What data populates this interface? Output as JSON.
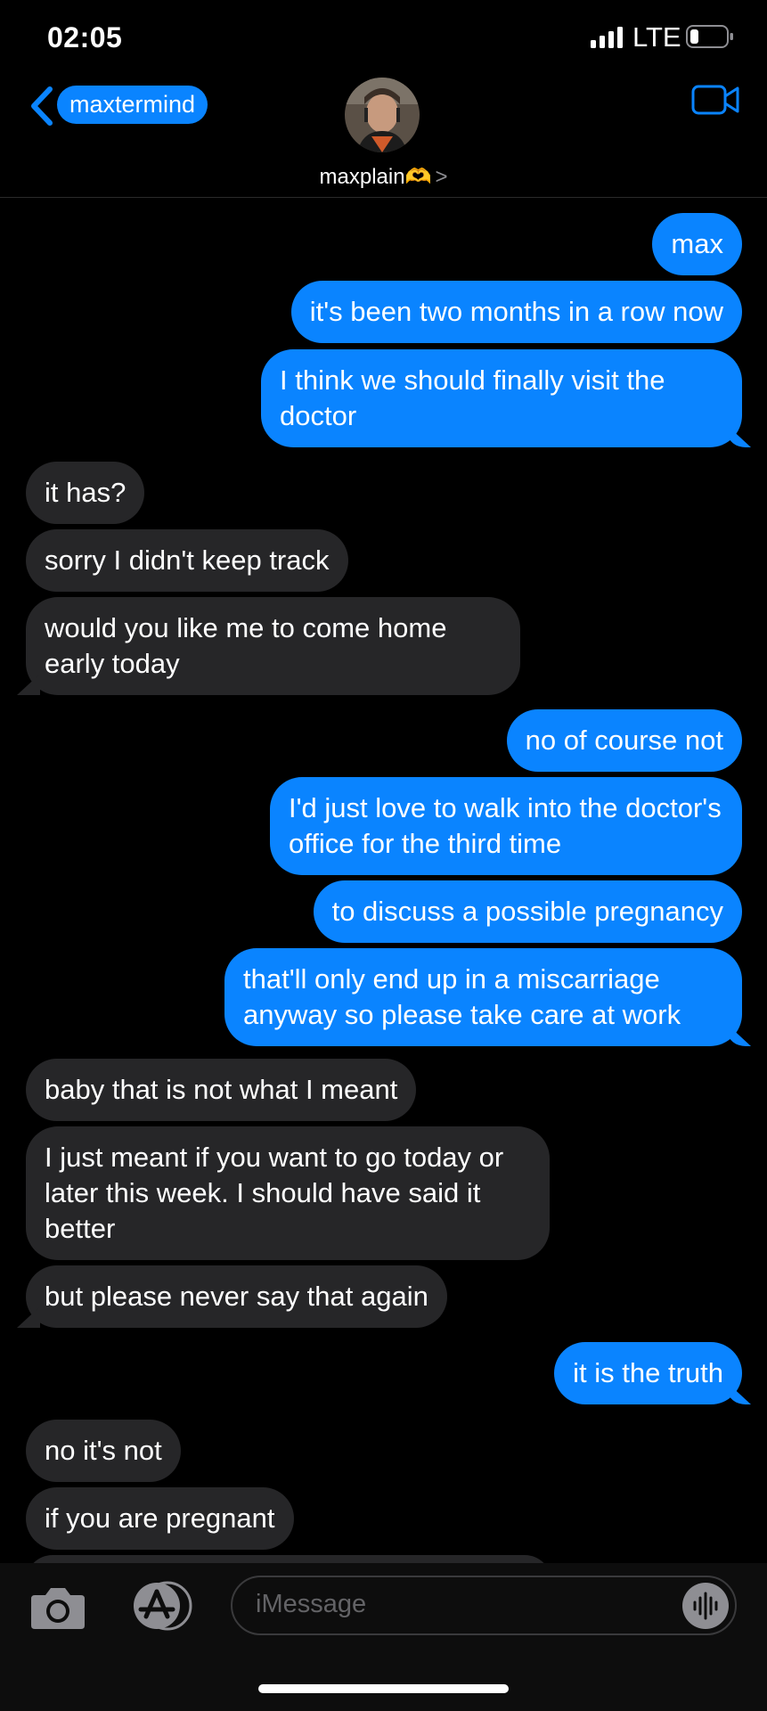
{
  "status": {
    "time": "02:05",
    "network": "LTE"
  },
  "nav": {
    "back_label": "maxtermind",
    "contact_name": "maxplain🫶",
    "contact_chevron": ">"
  },
  "input": {
    "placeholder": "iMessage"
  },
  "messages": [
    {
      "dir": "out",
      "text": "max"
    },
    {
      "dir": "out",
      "text": "it's been two months in a row now"
    },
    {
      "dir": "out",
      "text": "I think we should finally visit the doctor"
    },
    {
      "dir": "in",
      "text": "it has?"
    },
    {
      "dir": "in",
      "text": "sorry I didn't keep track"
    },
    {
      "dir": "in",
      "text": "would you like me to come home early today"
    },
    {
      "dir": "out",
      "text": "no of course not"
    },
    {
      "dir": "out",
      "text": "I'd just love to walk into the doctor's office for the third time"
    },
    {
      "dir": "out",
      "text": "to discuss a possible pregnancy"
    },
    {
      "dir": "out",
      "text": "that'll only end up in a miscarriage anyway so please take care at work"
    },
    {
      "dir": "in",
      "text": "baby that is not what I meant"
    },
    {
      "dir": "in",
      "text": "I just meant if you want to go today or later this week. I should have said it better"
    },
    {
      "dir": "in",
      "text": "but please never say that again"
    },
    {
      "dir": "out",
      "text": "it is the truth"
    },
    {
      "dir": "in",
      "text": "no it's not"
    },
    {
      "dir": "in",
      "text": "if you are pregnant"
    },
    {
      "dir": "in",
      "text": ""
    }
  ]
}
